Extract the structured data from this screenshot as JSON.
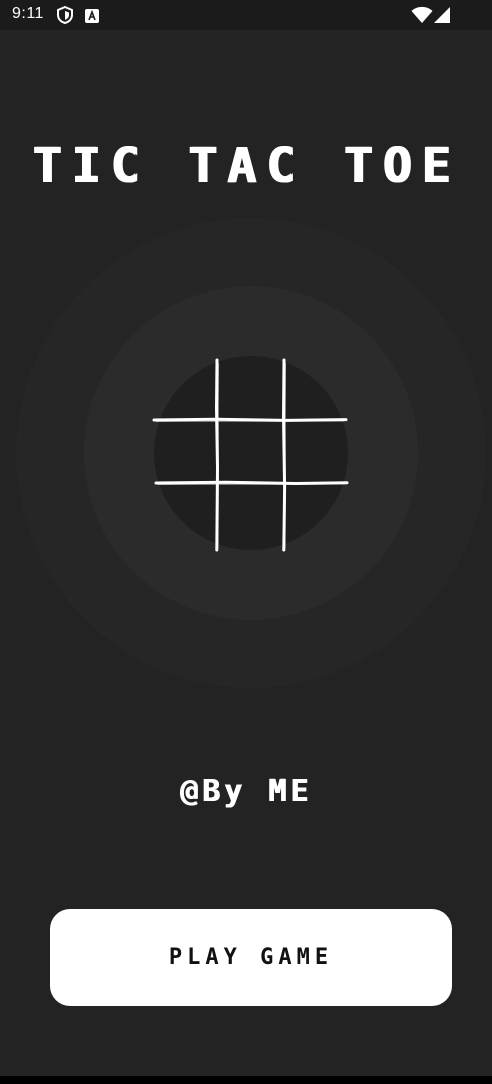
{
  "status_bar": {
    "time": "9:11",
    "left_icons": [
      "shield-icon",
      "keyboard-a-icon"
    ],
    "right_icons": [
      "wifi-icon",
      "signal-icon"
    ]
  },
  "title": "TIC TAC TOE",
  "credit": "@By ME",
  "play_button": {
    "label": "PLAY GAME"
  },
  "colors": {
    "background": "#232323",
    "text": "#ffffff",
    "button_bg": "#ffffff",
    "button_text": "#111111"
  }
}
